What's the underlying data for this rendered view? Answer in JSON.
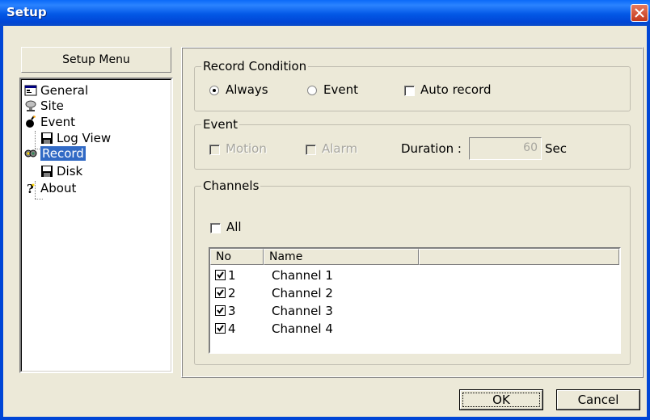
{
  "window": {
    "title": "Setup"
  },
  "menu": {
    "header": "Setup Menu",
    "items": [
      {
        "label": "General",
        "icon": "general-icon",
        "level": 0
      },
      {
        "label": "Site",
        "icon": "site-icon",
        "level": 0
      },
      {
        "label": "Event",
        "icon": "event-icon",
        "level": 0
      },
      {
        "label": "Log View",
        "icon": "disk-icon",
        "level": 1
      },
      {
        "label": "Record",
        "icon": "record-icon",
        "level": 0,
        "selected": true
      },
      {
        "label": "Disk",
        "icon": "disk-icon",
        "level": 1
      },
      {
        "label": "About",
        "icon": "help-icon",
        "level": 0
      }
    ]
  },
  "record_condition": {
    "title": "Record Condition",
    "always_label": "Always",
    "event_label": "Event",
    "auto_record_label": "Auto record",
    "selected": "Always",
    "auto_record": false
  },
  "event": {
    "title": "Event",
    "motion_label": "Motion",
    "alarm_label": "Alarm",
    "duration_label": "Duration :",
    "duration_value": "60",
    "duration_unit": "Sec"
  },
  "channels": {
    "title": "Channels",
    "all_label": "All",
    "columns": [
      "No",
      "Name"
    ],
    "rows": [
      {
        "no": "1",
        "name": "Channel 1",
        "checked": true
      },
      {
        "no": "2",
        "name": "Channel 2",
        "checked": true
      },
      {
        "no": "3",
        "name": "Channel 3",
        "checked": true
      },
      {
        "no": "4",
        "name": "Channel 4",
        "checked": true
      }
    ]
  },
  "buttons": {
    "ok": "OK",
    "cancel": "Cancel"
  },
  "colors": {
    "title_bar": "#0A5FEA",
    "selection": "#316AC5",
    "dialog_bg": "#ECE9D8"
  }
}
